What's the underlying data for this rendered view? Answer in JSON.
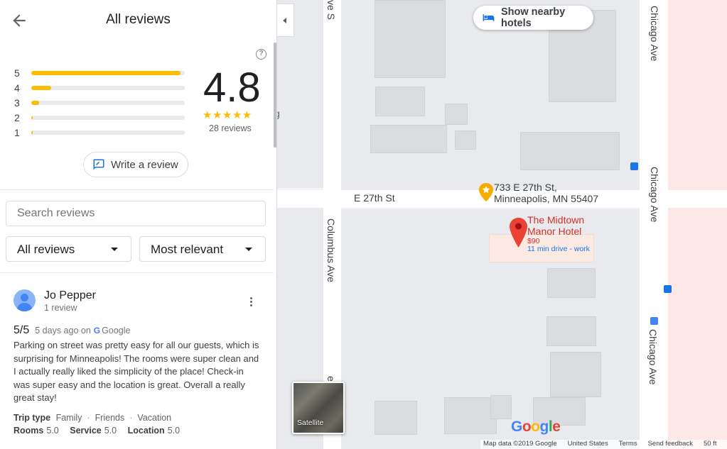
{
  "panel": {
    "title": "All reviews",
    "rating": "4.8",
    "stars": "★★★★★",
    "review_count": "28 reviews",
    "histogram": [
      {
        "stars": "5",
        "fraction": 0.97
      },
      {
        "stars": "4",
        "fraction": 0.13
      },
      {
        "stars": "3",
        "fraction": 0.05
      },
      {
        "stars": "2",
        "fraction": 0.01
      },
      {
        "stars": "1",
        "fraction": 0.01
      }
    ],
    "write_review_label": "Write a review",
    "search_placeholder": "Search reviews",
    "filter_label": "All reviews",
    "sort_label": "Most relevant"
  },
  "review": {
    "author": "Jo Pepper",
    "author_reviews": "1 review",
    "score": "5/5",
    "when": "5 days ago on",
    "source": "Google",
    "text": "Parking on street was pretty easy for all our guests, which is surprising for Minneapolis! The rooms were super clean and I actually really liked the simplicity of the place! Check-in was super easy and the location is great. Overall a really great stay!",
    "trip_type_label": "Trip type",
    "trip_types": [
      "Family",
      "Friends",
      "Vacation"
    ],
    "ratings": [
      {
        "label": "Rooms",
        "value": "5.0"
      },
      {
        "label": "Service",
        "value": "5.0"
      },
      {
        "label": "Location",
        "value": "5.0"
      }
    ]
  },
  "map": {
    "show_hotels_label": "Show nearby hotels",
    "street_labels": {
      "e27th": "E 27th St",
      "columbus": "Columbus Ave",
      "chicago_top": "Chicago Ave",
      "chicago_mid": "Chicago Ave",
      "chicago_bot": "Chicago Ave",
      "ave_s_top": "ve S",
      "ave_s_bot": "e S",
      "partial_g": "g"
    },
    "address_pin": {
      "line1": "733 E 27th St,",
      "line2": "Minneapolis, MN 55407"
    },
    "hotel_pin": {
      "name_line1": "The Midtown",
      "name_line2": "Manor Hotel",
      "price": "$90",
      "drive": "11 min drive - work"
    },
    "satellite_label": "Satellite",
    "google_logo": "Google",
    "footer": {
      "map_data": "Map data ©2019 Google",
      "region": "United States",
      "terms": "Terms",
      "feedback": "Send feedback",
      "scale": "50 ft"
    }
  },
  "colors": {
    "star": "#fbbc04",
    "accent": "#1a73e8",
    "pin_red": "#ea4335",
    "text": "#202124"
  }
}
